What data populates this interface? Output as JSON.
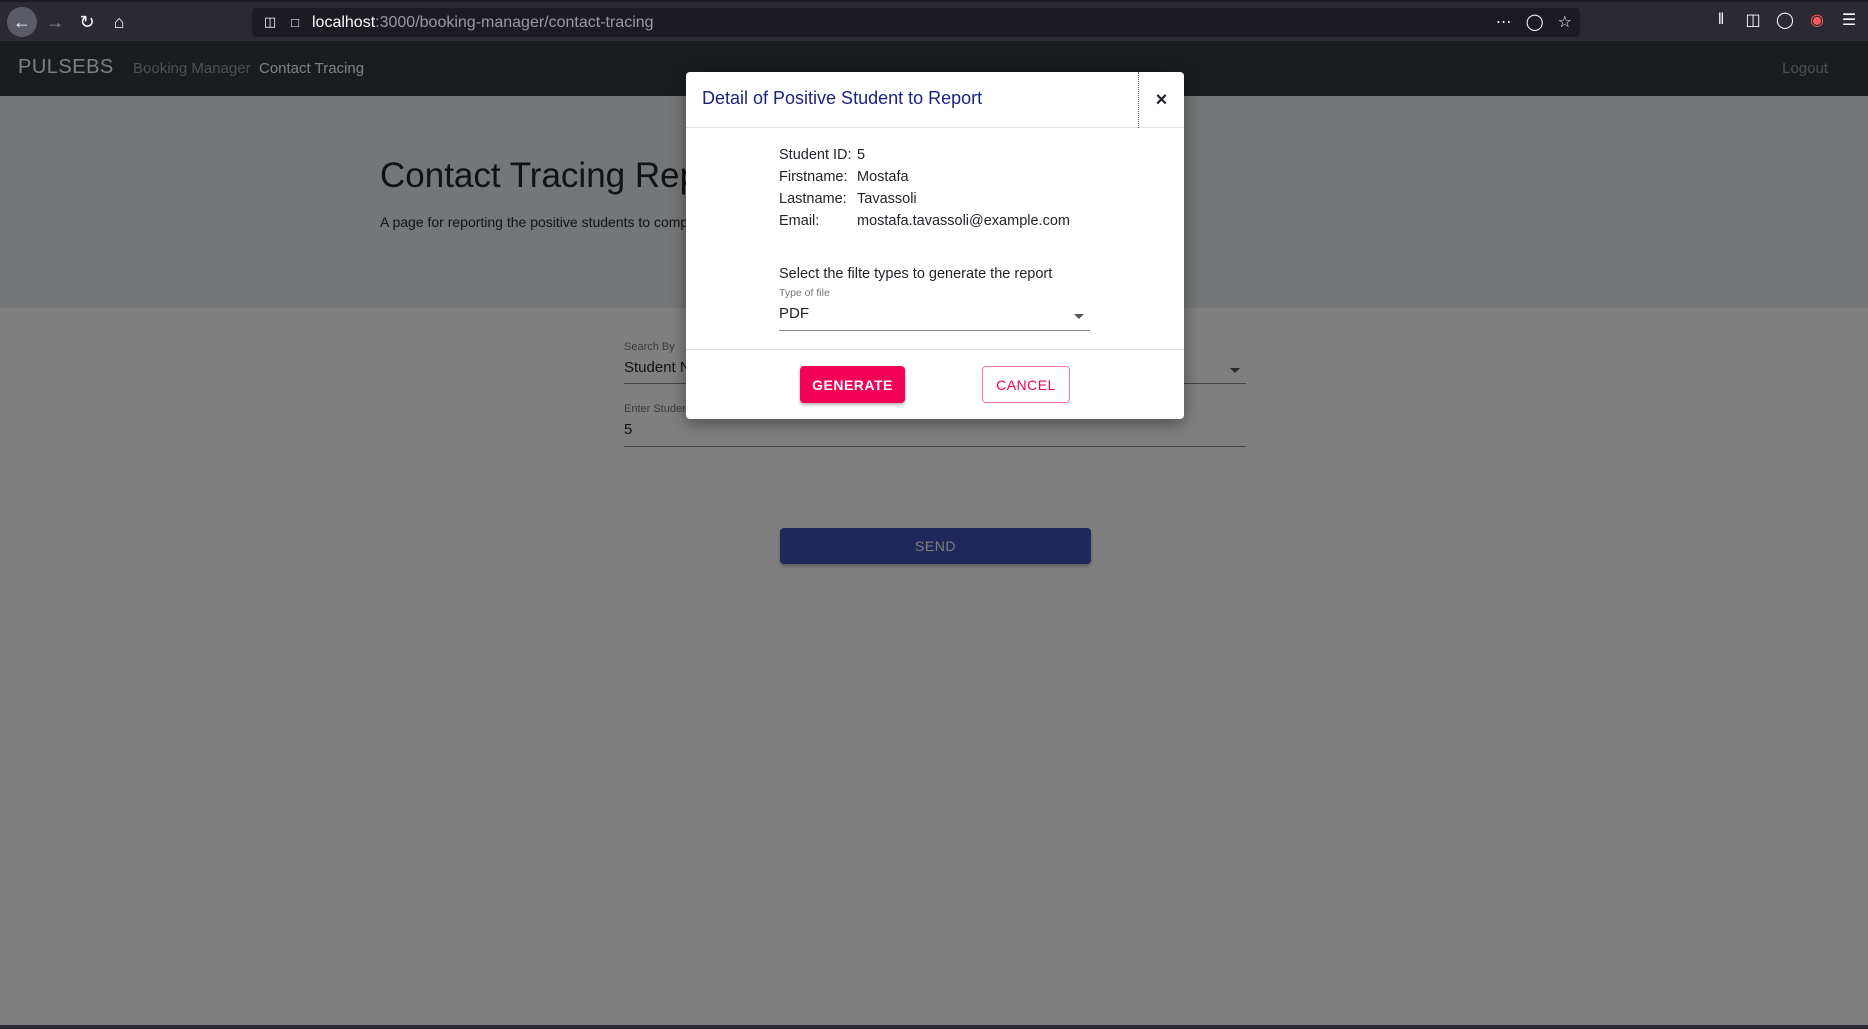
{
  "browser": {
    "url_host": "localhost",
    "url_path": ":3000/booking-manager/contact-tracing"
  },
  "navbar": {
    "brand": "PULSEBS",
    "links": [
      "Booking Manager",
      "Contact Tracing"
    ],
    "logout": "Logout"
  },
  "page": {
    "title": "Contact Tracing Report",
    "lead": "A page for reporting the positive students to competent authorities"
  },
  "form": {
    "search_by_label": "Search By",
    "search_by_value": "Student Number",
    "student_input_label": "Enter Student Number",
    "student_input_value": "5",
    "send_label": "SEND"
  },
  "modal": {
    "title": "Detail of Positive Student to Report",
    "close_symbol": "×",
    "details": [
      {
        "key": "Student ID:",
        "value": "5"
      },
      {
        "key": "Firstname:",
        "value": "Mostafa"
      },
      {
        "key": "Lastname:",
        "value": "Tavassoli"
      },
      {
        "key": "Email:",
        "value": "mostafa.tavassoli@example.com"
      }
    ],
    "select_prompt": "Select the filte types to generate the report",
    "file_type_label": "Type of file",
    "file_type_value": "PDF",
    "generate_label": "GENERATE",
    "cancel_label": "CANCEL"
  },
  "colors": {
    "navbar": "#343a40",
    "primary": "#3f51b5",
    "secondary": "#f50057",
    "modal_title": "#1a237e"
  }
}
